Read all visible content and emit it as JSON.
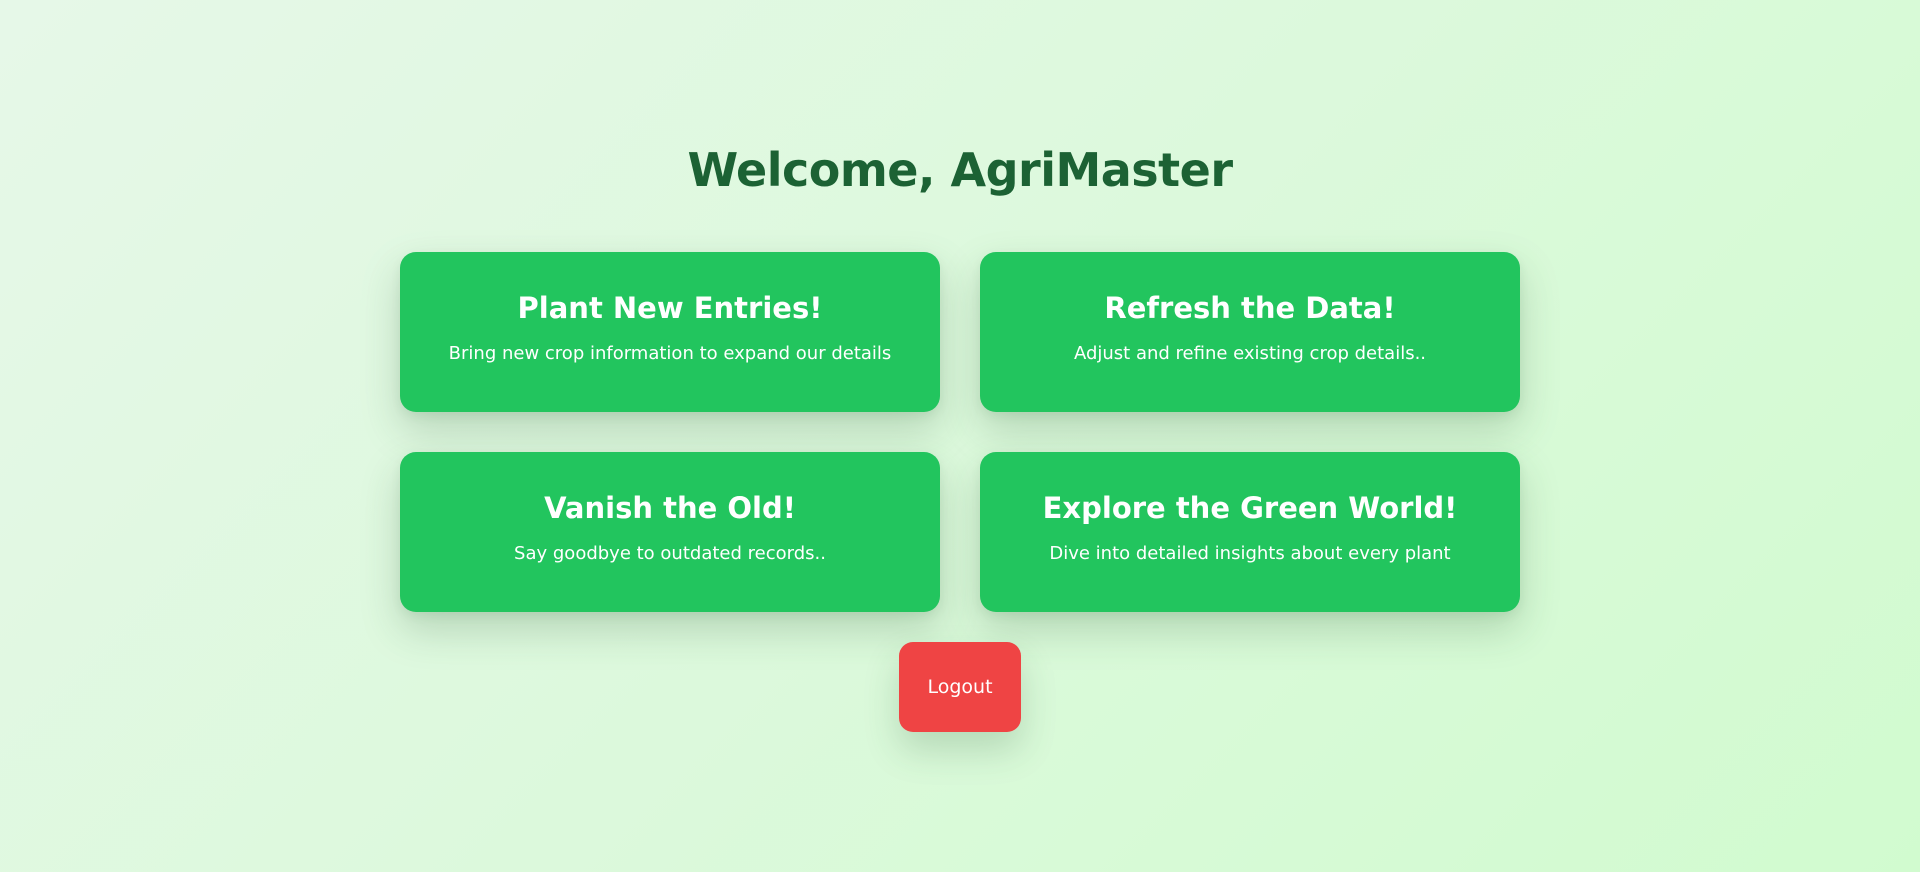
{
  "header": {
    "title": "Welcome, AgriMaster"
  },
  "cards": [
    {
      "title": "Plant New Entries!",
      "description": "Bring new crop information to expand our details"
    },
    {
      "title": "Refresh the Data!",
      "description": "Adjust and refine existing crop details.."
    },
    {
      "title": "Vanish the Old!",
      "description": "Say goodbye to outdated records.."
    },
    {
      "title": "Explore the Green World!",
      "description": "Dive into detailed insights about every plant"
    }
  ],
  "logout": {
    "label": "Logout"
  },
  "colors": {
    "card_background": "#22c55e",
    "logout_background": "#ef4444",
    "title_text": "#1c6234",
    "page_background": "#dcf9dc"
  }
}
